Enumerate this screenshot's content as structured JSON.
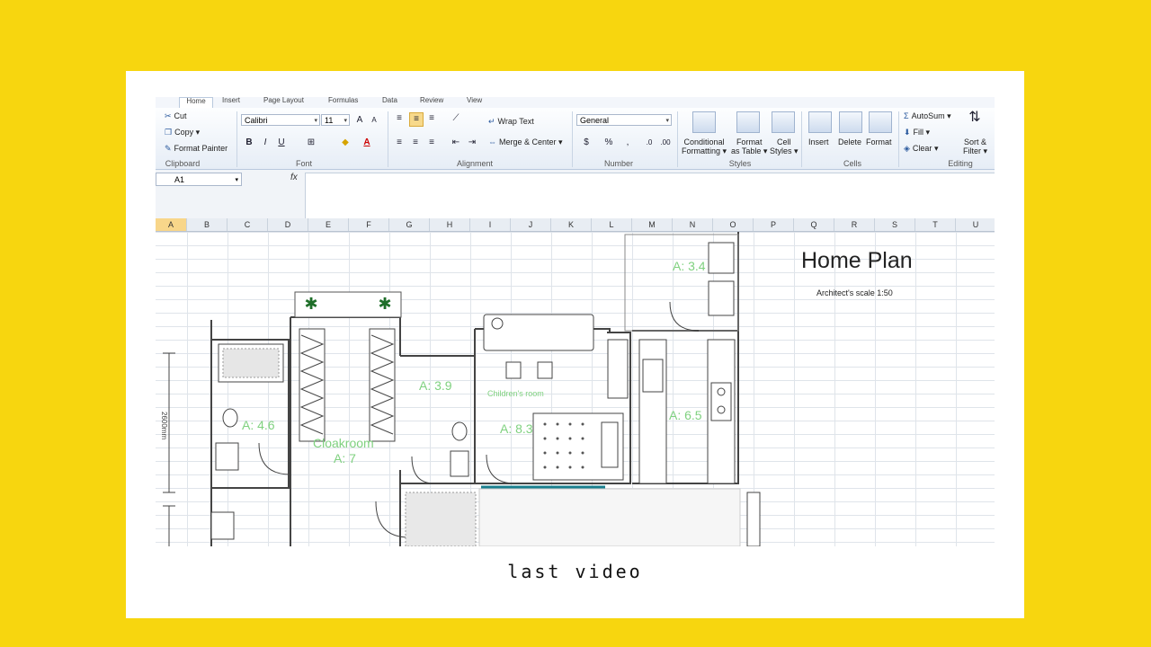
{
  "ribbon": {
    "tabs": [
      "Home",
      "Insert",
      "Page Layout",
      "Formulas",
      "Data",
      "Review",
      "View"
    ],
    "clipboard": {
      "cut": "Cut",
      "copy": "Copy",
      "format_painter": "Format Painter",
      "label": "Clipboard"
    },
    "font": {
      "name": "Calibri",
      "size": "11",
      "label": "Font",
      "bold": "B",
      "italic": "I",
      "underline": "U"
    },
    "alignment": {
      "wrap_text": "Wrap Text",
      "merge_center": "Merge & Center",
      "label": "Alignment"
    },
    "number": {
      "format": "General",
      "percent": "%",
      "label": "Number"
    },
    "styles": {
      "conditional_1": "Conditional",
      "conditional_2": "Formatting",
      "format_table_1": "Format",
      "format_table_2": "as Table",
      "cell_styles_1": "Cell",
      "cell_styles_2": "Styles",
      "label": "Styles"
    },
    "cells": {
      "insert": "Insert",
      "delete": "Delete",
      "format": "Format",
      "label": "Cells"
    },
    "editing": {
      "autosum": "AutoSum",
      "fill": "Fill",
      "clear": "Clear",
      "sort_1": "Sort &",
      "sort_2": "Filter",
      "label": "Editing"
    }
  },
  "formula_bar": {
    "name_box": "A1",
    "fx": "fx",
    "value": ""
  },
  "columns": [
    "A",
    "B",
    "C",
    "D",
    "E",
    "F",
    "G",
    "H",
    "I",
    "J",
    "K",
    "L",
    "M",
    "N",
    "O",
    "P",
    "Q",
    "R",
    "S",
    "T",
    "U"
  ],
  "selected_column": "A",
  "plan": {
    "title": "Home Plan",
    "scale": "Architect's scale 1:50",
    "rooms": [
      {
        "label": "A: 4.6"
      },
      {
        "label": "Cloakroom"
      },
      {
        "label": "A: 7"
      },
      {
        "label": "A: 3.9"
      },
      {
        "label": "Children's room"
      },
      {
        "label": "A: 8.3"
      },
      {
        "label": "A: 3.4"
      },
      {
        "label": "A: 6.5"
      }
    ],
    "dimension": "2600mm"
  },
  "caption": "last video",
  "colors": {
    "background": "#f7d60f",
    "room_label": "#7fd17f",
    "accent_wall": "#1a7f8e"
  }
}
